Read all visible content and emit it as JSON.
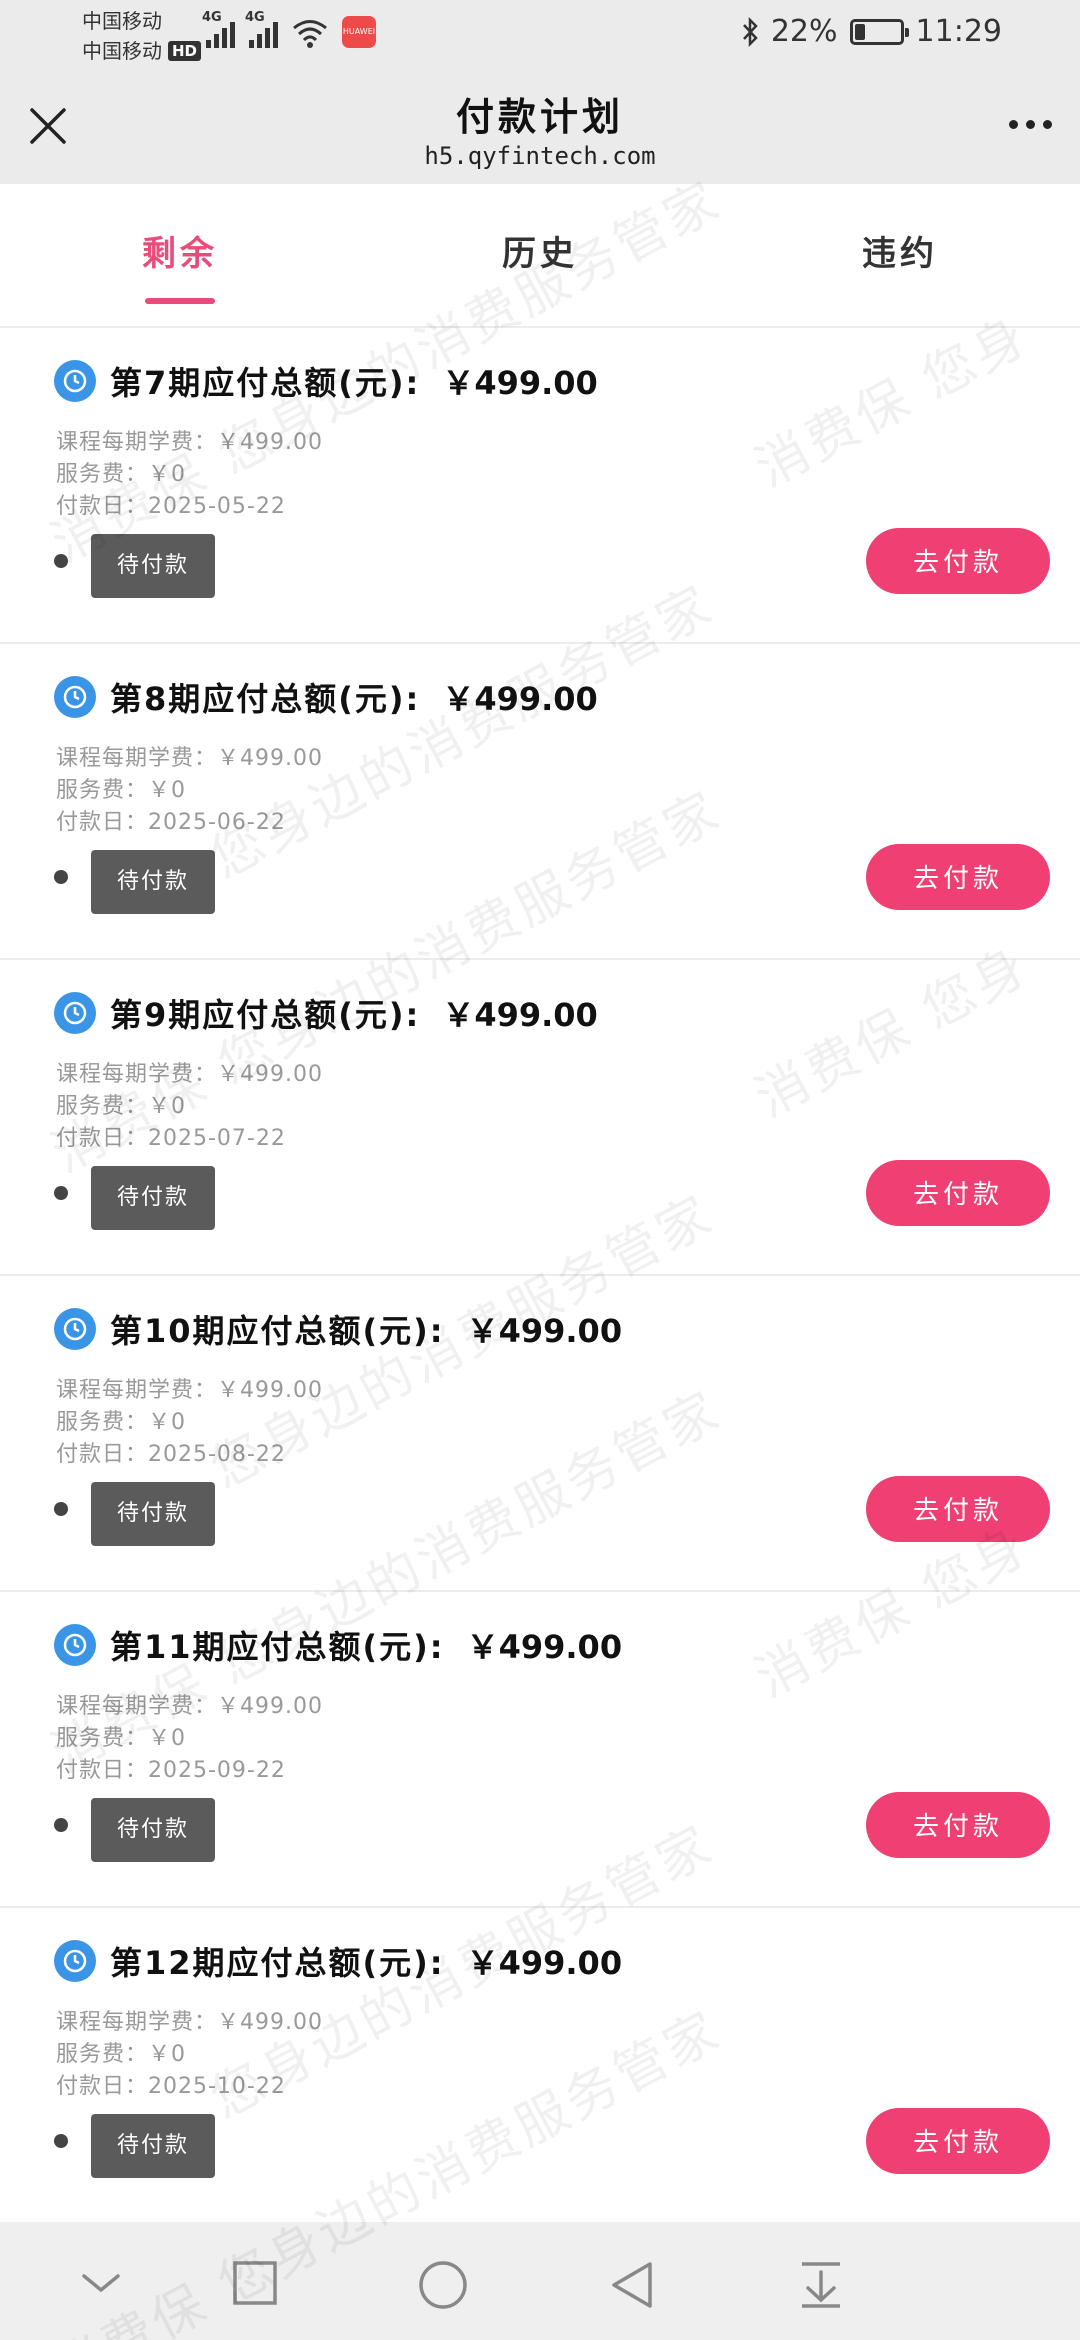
{
  "status_bar": {
    "carrier_1": "中国移动",
    "carrier_2": "中国移动",
    "hd": "HD",
    "network_1": "4G",
    "network_2": "4G",
    "app_badge": "HUAWEI",
    "battery_percent": "22%",
    "battery_level": 0.22,
    "time": "11:29"
  },
  "header": {
    "title": "付款计划",
    "url": "h5.qyfintech.com"
  },
  "tabs": [
    {
      "label": "剩余",
      "active": true
    },
    {
      "label": "历史",
      "active": false
    },
    {
      "label": "违约",
      "active": false
    }
  ],
  "cards": [
    {
      "title": "第7期应付总额(元):",
      "amount": "￥499.00",
      "tuition": "课程每期学费：￥499.00",
      "fee": "服务费：￥0",
      "date": "付款日：2025-05-22",
      "status": "待付款",
      "pay": "去付款"
    },
    {
      "title": "第8期应付总额(元):",
      "amount": "￥499.00",
      "tuition": "课程每期学费：￥499.00",
      "fee": "服务费：￥0",
      "date": "付款日：2025-06-22",
      "status": "待付款",
      "pay": "去付款"
    },
    {
      "title": "第9期应付总额(元):",
      "amount": "￥499.00",
      "tuition": "课程每期学费：￥499.00",
      "fee": "服务费：￥0",
      "date": "付款日：2025-07-22",
      "status": "待付款",
      "pay": "去付款"
    },
    {
      "title": "第10期应付总额(元):",
      "amount": "￥499.00",
      "tuition": "课程每期学费：￥499.00",
      "fee": "服务费：￥0",
      "date": "付款日：2025-08-22",
      "status": "待付款",
      "pay": "去付款"
    },
    {
      "title": "第11期应付总额(元):",
      "amount": "￥499.00",
      "tuition": "课程每期学费：￥499.00",
      "fee": "服务费：￥0",
      "date": "付款日：2025-09-22",
      "status": "待付款",
      "pay": "去付款"
    },
    {
      "title": "第12期应付总额(元):",
      "amount": "￥499.00",
      "tuition": "课程每期学费：￥499.00",
      "fee": "服务费：￥0",
      "date": "付款日：2025-10-22",
      "status": "待付款",
      "pay": "去付款"
    }
  ],
  "watermark": {
    "text_a": "消费保 您身边的消费服务管家",
    "text_b": "您身边的消费服务管家",
    "text_c": "消费保 您身"
  },
  "icons": {
    "close": "close-icon",
    "more": "more-icon",
    "clock": "clock-icon",
    "nav": [
      "chevron-down-icon",
      "square-icon",
      "circle-icon",
      "back-triangle-icon",
      "pull-down-icon"
    ]
  },
  "colors": {
    "accent": "#e84c7b",
    "pay_button": "#f03f72",
    "clock_badge": "#3a95e7",
    "status_tag": "#5b5b5b"
  }
}
